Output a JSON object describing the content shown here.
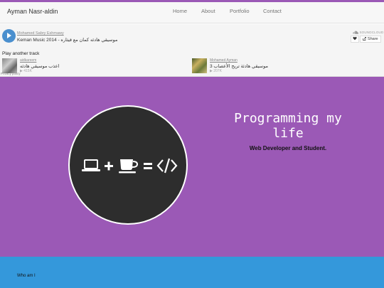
{
  "navbar": {
    "brand": "Ayman Nasr-aldin",
    "links": [
      "Home",
      "About",
      "Portfolio",
      "Contact"
    ]
  },
  "player": {
    "user": "Mohamed Sabry Eshmawy",
    "title": "Keman Music 2014 - موسيقي هادئه كمان مع قيثاره",
    "logo_text": "SOUNDCLOUD",
    "like_icon": "heart-icon",
    "share_label": "Share",
    "play_another": "Play another track",
    "tracks": [
      {
        "user": "aidkareem",
        "title": "اعذب موسيقي هادئه",
        "plays": "415K"
      },
      {
        "user": "Mohamed Ayman",
        "title": "موسيقي هادئة تريح الأعصاب 3",
        "plays": "207K"
      }
    ],
    "privacy": "Privacy policy"
  },
  "hero": {
    "title": "Programming my life",
    "subtitle": "Web Developer and Student.",
    "icons": [
      "laptop-icon",
      "plus-icon",
      "coffee-cup-icon",
      "equals-icon",
      "code-icon"
    ]
  },
  "about": {
    "title": "Who am I"
  },
  "colors": {
    "accent_purple": "#9b59b6",
    "accent_blue": "#3498db",
    "play_blue": "#4a8fce",
    "circle_dark": "#2d2d2d"
  }
}
